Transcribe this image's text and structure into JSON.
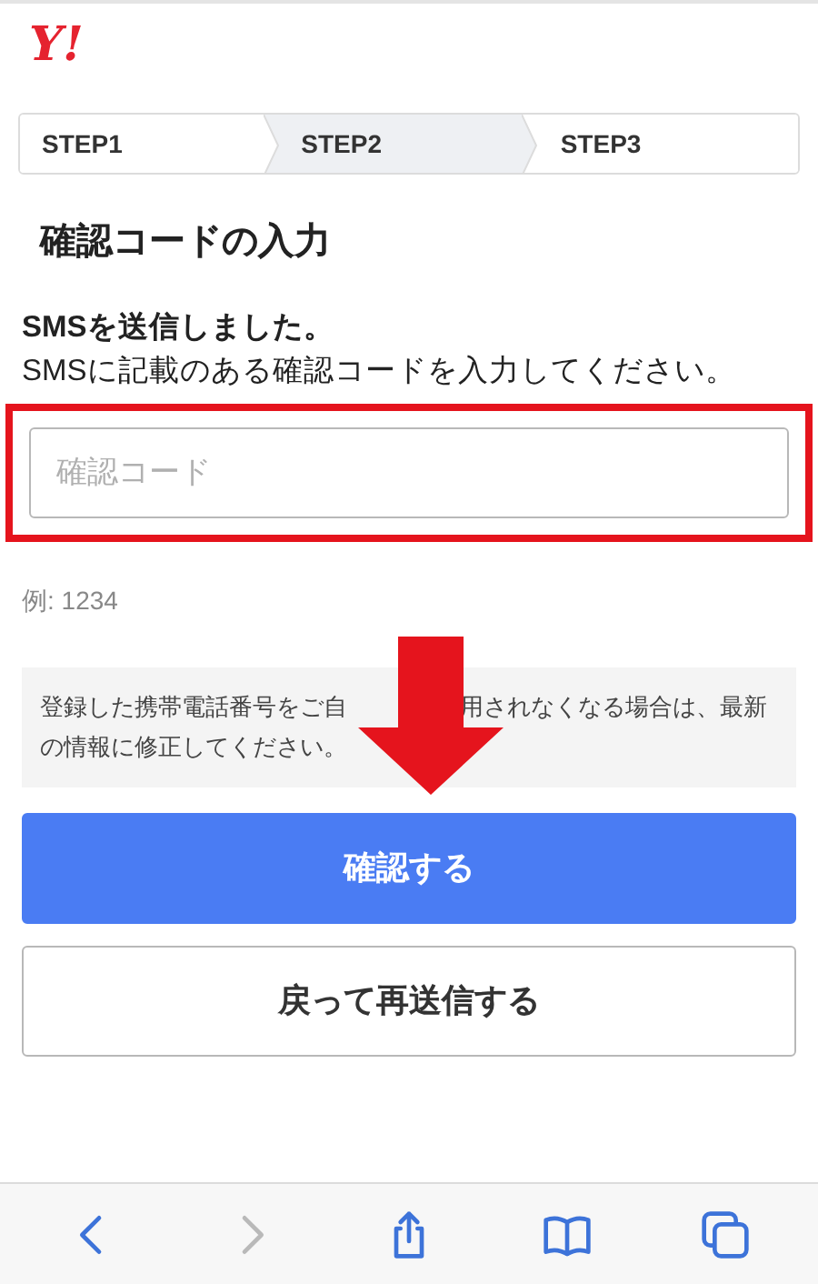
{
  "logo": "Y!",
  "steps": [
    {
      "label": "STEP1",
      "selected": false
    },
    {
      "label": "STEP2",
      "selected": true
    },
    {
      "label": "STEP3",
      "selected": false
    }
  ],
  "heading": "確認コードの入力",
  "message": {
    "title": "SMSを送信しました。",
    "body": "SMSに記載のある確認コードを入力してください。"
  },
  "code_field": {
    "placeholder": "確認コード",
    "highlighted": true
  },
  "example": "例: 1234",
  "notice": {
    "line_1_start": "登録した携帯電話番号をご自",
    "line_1_end": "用されなくなる場合は、最新",
    "line_2": "の情報に修正してください。"
  },
  "buttons": [
    {
      "label": "確認する",
      "kind": "primary"
    },
    {
      "label": "戻って再送信する",
      "kind": "secondary"
    }
  ],
  "toolbar": [
    {
      "kind": "back",
      "disabled": false
    },
    {
      "kind": "forward",
      "disabled": true
    },
    {
      "kind": "share",
      "disabled": false
    },
    {
      "kind": "bookmarks",
      "disabled": false
    },
    {
      "kind": "tabs",
      "disabled": false
    }
  ]
}
